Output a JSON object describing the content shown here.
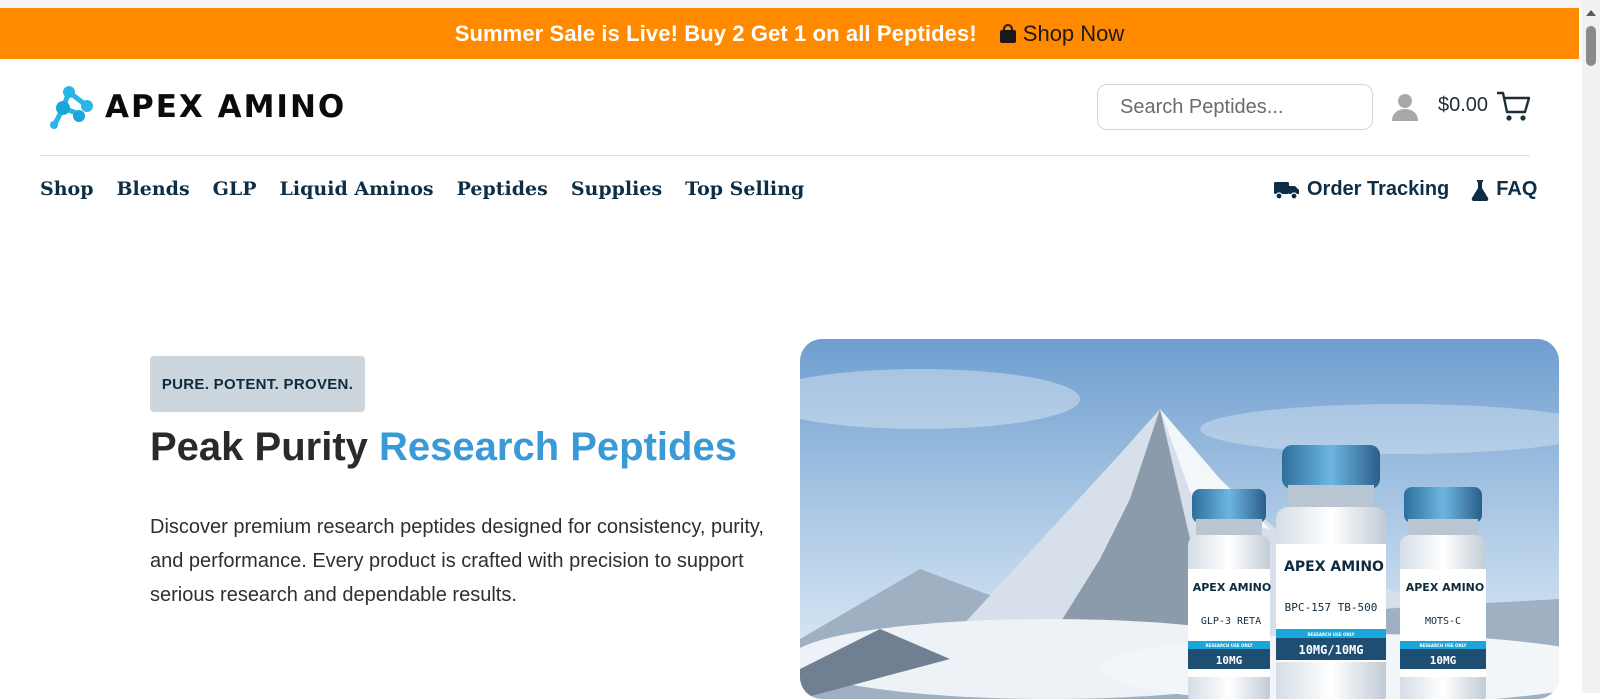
{
  "promo": {
    "text": "Summer Sale is Live! Buy 2 Get 1 on all Peptides!",
    "link_label": "Shop Now"
  },
  "header": {
    "logo_text": "APEX AMINO",
    "search_placeholder": "Search Peptides...",
    "cart_total": "$0.00"
  },
  "nav": {
    "items": [
      "Shop",
      "Blends",
      "GLP",
      "Liquid Aminos",
      "Peptides",
      "Supplies",
      "Top Selling"
    ],
    "order_tracking": "Order Tracking",
    "faq": "FAQ"
  },
  "hero": {
    "badge": "PURE. POTENT. PROVEN.",
    "headline_dark": "Peak Purity",
    "headline_accent": "Research Peptides",
    "description": "Discover premium research peptides designed for consistency, purity, and performance. Every product is crafted with precision to support serious research and dependable results.",
    "vials": [
      {
        "brand": "APEX AMINO",
        "name": "GLP-3 RETA",
        "dose": "10MG",
        "footer": "RESEARCH USE ONLY"
      },
      {
        "brand": "APEX AMINO",
        "name": "BPC-157 TB-500",
        "dose": "10MG/10MG",
        "footer": "RESEARCH USE ONLY"
      },
      {
        "brand": "APEX AMINO",
        "name": "MOTS-C",
        "dose": "10MG",
        "footer": "RESEARCH USE ONLY"
      }
    ]
  },
  "colors": {
    "promo_bg": "#ff8a00",
    "accent_blue": "#3a9ad6",
    "nav_text": "#0d2e45",
    "badge_bg": "#cdd5dc"
  }
}
